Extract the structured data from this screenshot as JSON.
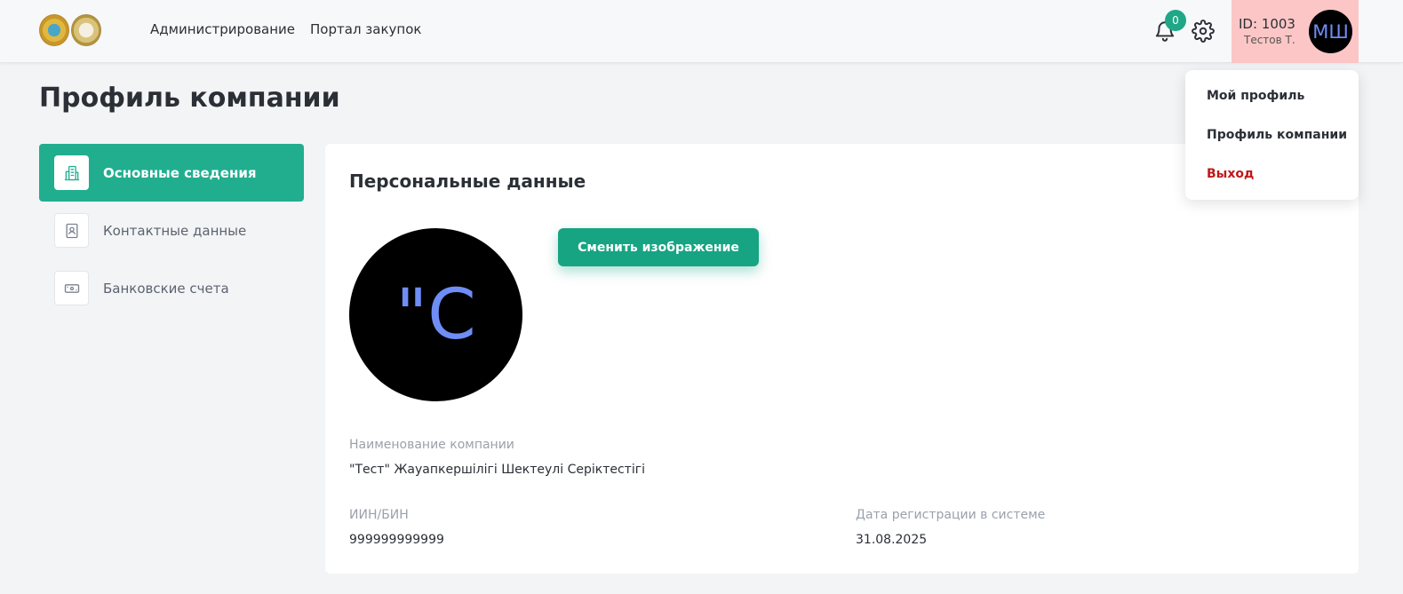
{
  "header": {
    "nav": [
      "Администрирование",
      "Портал закупок"
    ],
    "notification_count": "0",
    "user_id": "ID: 1003",
    "user_name": "Тестов Т.",
    "avatar_initials": "МШ"
  },
  "page": {
    "title": "Профиль компании"
  },
  "sidebar": {
    "items": [
      {
        "label": "Основные сведения",
        "icon": "building-icon",
        "active": true
      },
      {
        "label": "Контактные данные",
        "icon": "contact-book-icon",
        "active": false
      },
      {
        "label": "Банковские счета",
        "icon": "banknote-icon",
        "active": false
      }
    ]
  },
  "main": {
    "section_title": "Персональные данные",
    "avatar_text": "\"С",
    "change_image_label": "Сменить изображение",
    "company_name_label": "Наименование компании",
    "company_name_value": "\"Тест\" Жауапкершілігі Шектеулі Серіктестігі",
    "bin_label": "ИИН/БИН",
    "bin_value": "999999999999",
    "reg_date_label": "Дата регистрации в системе",
    "reg_date_value": "31.08.2025"
  },
  "dropdown": {
    "items": [
      "Мой профиль",
      "Профиль компании",
      "Выход"
    ]
  },
  "colors": {
    "accent": "#21ae8f",
    "logout": "#c01818",
    "user_box": "#fcc6c6"
  }
}
